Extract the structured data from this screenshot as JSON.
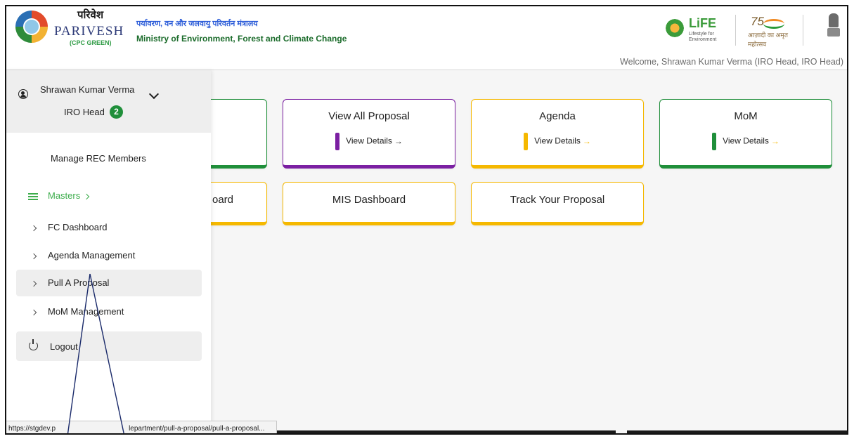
{
  "header": {
    "brand_hindi": "परिवेश",
    "brand_name": "PARIVESH",
    "brand_sub": "(CPC GREEN)",
    "ministry_hindi": "पर्यावरण, वन और जलवायु परिवर्तन मंत्रालय",
    "ministry_en": "Ministry of Environment, Forest and Climate Change",
    "life_logo": "LiFE",
    "life_sub": "Lifestyle for Environment",
    "azadi_num": "75",
    "azadi_text": "आज़ादी का अमृत महोत्सव",
    "welcome": "Welcome, Shrawan Kumar Verma (IRO Head, IRO Head)"
  },
  "sidebar": {
    "user_name": "Shrawan Kumar Verma",
    "user_role": "IRO Head",
    "role_badge": "2",
    "manage_rec": "Manage REC Members",
    "masters": "Masters",
    "items": [
      {
        "label": "FC Dashboard"
      },
      {
        "label": "Agenda Management"
      },
      {
        "label": "Pull A Proposal"
      },
      {
        "label": "MoM Management"
      }
    ],
    "logout": "Logout"
  },
  "cards": [
    {
      "title": "View All Proposal",
      "details": "View Details",
      "accent": "#7b1fa2"
    },
    {
      "title": "Agenda",
      "details": "View Details",
      "accent": "#f5b800"
    },
    {
      "title": "MoM",
      "details": "View Details",
      "accent": "#1f8f3a"
    },
    {
      "title": "MIS Dashboard",
      "accent": "#f5b800"
    },
    {
      "title": "Track Your Proposal",
      "accent": "#f5b800"
    }
  ],
  "partial_cards": [
    {
      "text": "",
      "accent": "#1f8f3a"
    },
    {
      "text": "oard",
      "accent": "#f5b800"
    }
  ],
  "status_url": {
    "start": "https://stgdev.p",
    "end": "lepartment/pull-a-proposal/pull-a-proposal..."
  },
  "colors": {
    "green": "#1f8f3a",
    "masters_green": "#3dad4c",
    "purple": "#7b1fa2",
    "yellow": "#f5b800"
  }
}
